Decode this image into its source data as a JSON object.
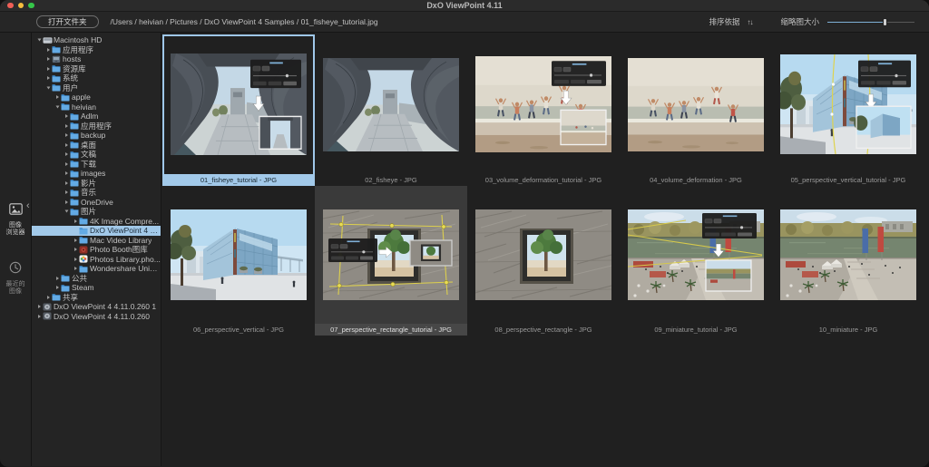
{
  "window": {
    "title": "DxO ViewPoint 4.11"
  },
  "titlebar_buttons": [
    "close",
    "minimize",
    "zoom"
  ],
  "toolbar": {
    "open_button": "打开文件夹",
    "breadcrumb": "/Users / heivian / Pictures / DxO ViewPoint 4 Samples / 01_fisheye_tutorial.jpg",
    "sort_label": "排序依据",
    "sort_icon": "↑↓",
    "size_label": "缩略图大小",
    "slider_percent": 66
  },
  "nav_rail": {
    "items": [
      {
        "id": "image-browser",
        "label": "图像\n浏览器",
        "icon": "image-browser-icon",
        "active": true
      },
      {
        "id": "recent-images",
        "label": "最近的\n图像",
        "icon": "clock-icon",
        "active": false
      }
    ]
  },
  "sidebar": {
    "tree": [
      {
        "label": "Macintosh HD",
        "level": 0,
        "expand": "open",
        "icon": "disk"
      },
      {
        "label": "应用程序",
        "level": 1,
        "expand": "closed",
        "icon": "folder"
      },
      {
        "label": "hosts",
        "level": 1,
        "expand": "closed",
        "icon": "hosts"
      },
      {
        "label": "资源库",
        "level": 1,
        "expand": "closed",
        "icon": "folder"
      },
      {
        "label": "系统",
        "level": 1,
        "expand": "closed",
        "icon": "folder"
      },
      {
        "label": "用户",
        "level": 1,
        "expand": "open",
        "icon": "folder"
      },
      {
        "label": "apple",
        "level": 2,
        "expand": "closed",
        "icon": "folder"
      },
      {
        "label": "heivian",
        "level": 2,
        "expand": "open",
        "icon": "folder"
      },
      {
        "label": "Adlm",
        "level": 3,
        "expand": "closed",
        "icon": "folder"
      },
      {
        "label": "应用程序",
        "level": 3,
        "expand": "closed",
        "icon": "folder"
      },
      {
        "label": "backup",
        "level": 3,
        "expand": "closed",
        "icon": "folder"
      },
      {
        "label": "桌面",
        "level": 3,
        "expand": "closed",
        "icon": "folder"
      },
      {
        "label": "文稿",
        "level": 3,
        "expand": "closed",
        "icon": "folder"
      },
      {
        "label": "下载",
        "level": 3,
        "expand": "closed",
        "icon": "folder"
      },
      {
        "label": "images",
        "level": 3,
        "expand": "closed",
        "icon": "folder"
      },
      {
        "label": "影片",
        "level": 3,
        "expand": "closed",
        "icon": "folder"
      },
      {
        "label": "音乐",
        "level": 3,
        "expand": "closed",
        "icon": "folder"
      },
      {
        "label": "OneDrive",
        "level": 3,
        "expand": "closed",
        "icon": "folder"
      },
      {
        "label": "图片",
        "level": 3,
        "expand": "open",
        "icon": "folder"
      },
      {
        "label": "4K Image Compre...",
        "level": 4,
        "expand": "closed",
        "icon": "folder"
      },
      {
        "label": "DxO ViewPoint 4 S...",
        "level": 4,
        "expand": "none",
        "icon": "folder",
        "selected": true
      },
      {
        "label": "Mac Video Library",
        "level": 4,
        "expand": "closed",
        "icon": "folder"
      },
      {
        "label": "Photo Booth图库",
        "level": 4,
        "expand": "closed",
        "icon": "photobooth"
      },
      {
        "label": "Photos Library.pho...",
        "level": 4,
        "expand": "closed",
        "icon": "photos"
      },
      {
        "label": "Wondershare UniC...",
        "level": 4,
        "expand": "closed",
        "icon": "folder"
      },
      {
        "label": "公共",
        "level": 2,
        "expand": "closed",
        "icon": "folder"
      },
      {
        "label": "Steam",
        "level": 2,
        "expand": "closed",
        "icon": "folder"
      },
      {
        "label": "共享",
        "level": 1,
        "expand": "closed",
        "icon": "folder"
      },
      {
        "label": "DxO ViewPoint 4 4.11.0.260 1",
        "level": 0,
        "expand": "closed",
        "icon": "diskimage"
      },
      {
        "label": "DxO ViewPoint 4 4.11.0.260",
        "level": 0,
        "expand": "closed",
        "icon": "diskimage"
      }
    ]
  },
  "grid": {
    "cells": [
      {
        "label": "01_fisheye_tutorial - JPG",
        "scene": "fisheye",
        "tutorial": true,
        "state": "selected"
      },
      {
        "label": "02_fisheye - JPG",
        "scene": "fisheye",
        "tutorial": false,
        "state": "normal"
      },
      {
        "label": "03_volume_deformation_tutorial - JPG",
        "scene": "beach",
        "tutorial": true,
        "state": "normal"
      },
      {
        "label": "04_volume_deformation - JPG",
        "scene": "beach",
        "tutorial": false,
        "state": "normal"
      },
      {
        "label": "05_perspective_vertical_tutorial - JPG",
        "scene": "building",
        "tutorial": true,
        "state": "normal"
      },
      {
        "label": "06_perspective_vertical - JPG",
        "scene": "building",
        "tutorial": false,
        "state": "normal"
      },
      {
        "label": "07_perspective_rectangle_tutorial - JPG",
        "scene": "wall",
        "tutorial": true,
        "state": "hover"
      },
      {
        "label": "08_perspective_rectangle - JPG",
        "scene": "wall",
        "tutorial": false,
        "state": "normal"
      },
      {
        "label": "09_miniature_tutorial - JPG",
        "scene": "harbor",
        "tutorial": true,
        "state": "normal"
      },
      {
        "label": "10_miniature - JPG",
        "scene": "harbor",
        "tutorial": false,
        "state": "normal"
      }
    ]
  },
  "colors": {
    "accent_selection": "#a2c9e9",
    "selection_text": "#17262f",
    "hover_cell": "#3a3a3a",
    "thumb_label_text": "#9a9a9a",
    "guide_line_yellow": "#dccf4e",
    "slider_fill": "#7fb0d6"
  }
}
